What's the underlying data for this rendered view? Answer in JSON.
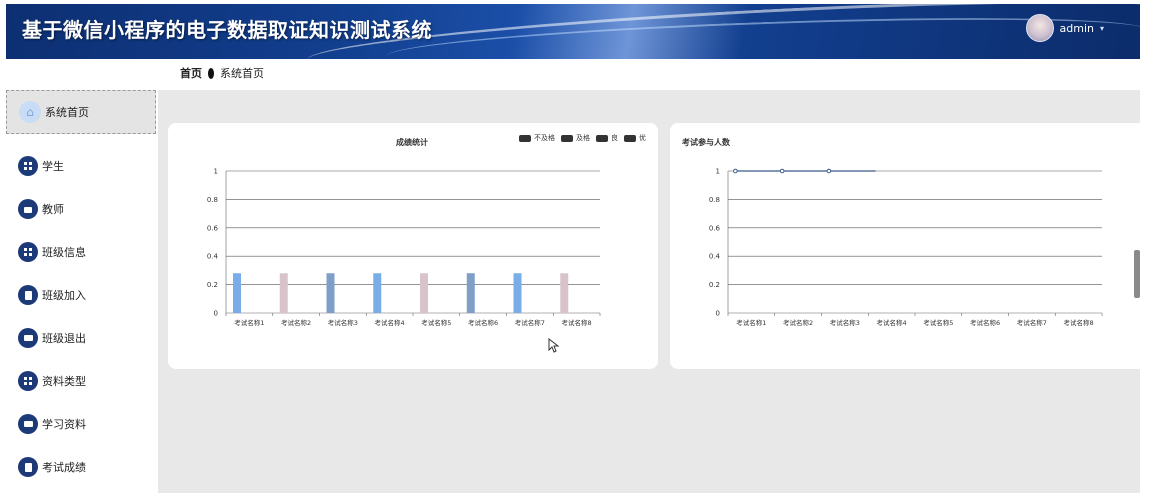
{
  "header": {
    "title": "基于微信小程序的电子数据取证知识测试系统",
    "username": "admin",
    "caret": "▾"
  },
  "breadcrumb": {
    "home": "首页",
    "current": "系统首页"
  },
  "sidebar": {
    "home_label": "系统首页",
    "items": [
      {
        "label": "学生",
        "icon": "grid-icon"
      },
      {
        "label": "教师",
        "icon": "briefcase-icon"
      },
      {
        "label": "班级信息",
        "icon": "grid-icon"
      },
      {
        "label": "班级加入",
        "icon": "document-icon"
      },
      {
        "label": "班级退出",
        "icon": "message-icon"
      },
      {
        "label": "资料类型",
        "icon": "grid-icon"
      },
      {
        "label": "学习资料",
        "icon": "message-icon"
      },
      {
        "label": "考试成绩",
        "icon": "document-icon"
      }
    ]
  },
  "chart_data": [
    {
      "type": "bar",
      "title": "成绩统计",
      "categories": [
        "考试名称1",
        "考试名称2",
        "考试名称3",
        "考试名称4",
        "考试名称5",
        "考试名称6",
        "考试名称7",
        "考试名称8"
      ],
      "yticks": [
        "0",
        "0.2",
        "0.4",
        "0.6",
        "0.8",
        "1"
      ],
      "ylim": [
        0,
        1
      ],
      "values": [
        0.28,
        0.28,
        0.28,
        0.28,
        0.28,
        0.28,
        0.28,
        0.28
      ],
      "bar_colors": [
        "#7aace8",
        "#d9c3cb",
        "#7f9fc9",
        "#7aace8",
        "#d9c3cb",
        "#7f9fc9",
        "#7aace8",
        "#d9c3cb"
      ],
      "legend": [
        "不及格",
        "及格",
        "良",
        "优"
      ],
      "legend_position": "top-right",
      "grid": true
    },
    {
      "type": "line",
      "title": "考试参与人数",
      "categories": [
        "考试名称1",
        "考试名称2",
        "考试名称3",
        "考试名称4",
        "考试名称5",
        "考试名称6",
        "考试名称7",
        "考试名称8"
      ],
      "yticks": [
        "0",
        "0.2",
        "0.4",
        "0.6",
        "0.8",
        "1"
      ],
      "ylim": [
        0,
        1
      ],
      "values": [
        1,
        1,
        1,
        1
      ],
      "line_color": "#3b5b8a",
      "grid": true
    }
  ]
}
